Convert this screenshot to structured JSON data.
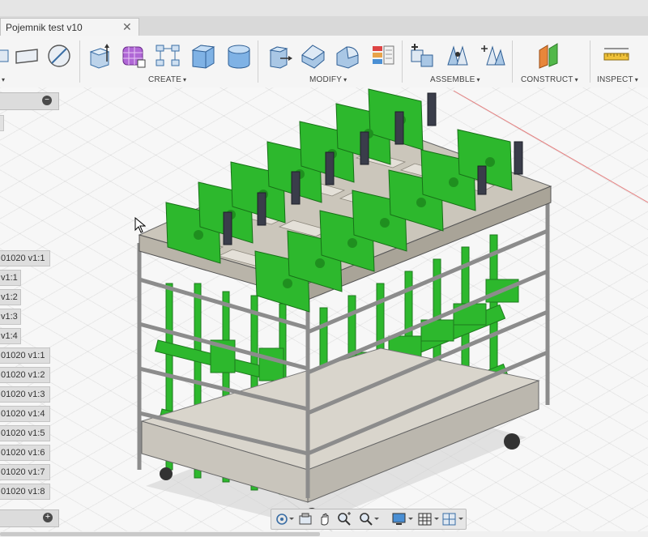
{
  "document": {
    "tab_title": "Pojemnik test v10",
    "close_glyph": "✕"
  },
  "toolbar": {
    "groups": [
      {
        "label": "CREATE"
      },
      {
        "label": "MODIFY"
      },
      {
        "label": "ASSEMBLE"
      },
      {
        "label": "CONSTRUCT"
      },
      {
        "label": "INSPECT"
      }
    ],
    "caret": "▾"
  },
  "browser": {
    "items": [
      "01020 v1:1",
      "v1:1",
      "v1:2",
      "v1:3",
      "v1:4",
      "01020 v1:1",
      "01020 v1:2",
      "01020 v1:3",
      "01020 v1:4",
      "01020 v1:5",
      "01020 v1:6",
      "01020 v1:7",
      "01020 v1:8"
    ],
    "collapse_glyph": "−",
    "add_glyph": "+"
  },
  "colors": {
    "accent_green": "#2db82d",
    "frame_gray": "#8c8c8c",
    "bracket_dark": "#3a3d4a"
  }
}
